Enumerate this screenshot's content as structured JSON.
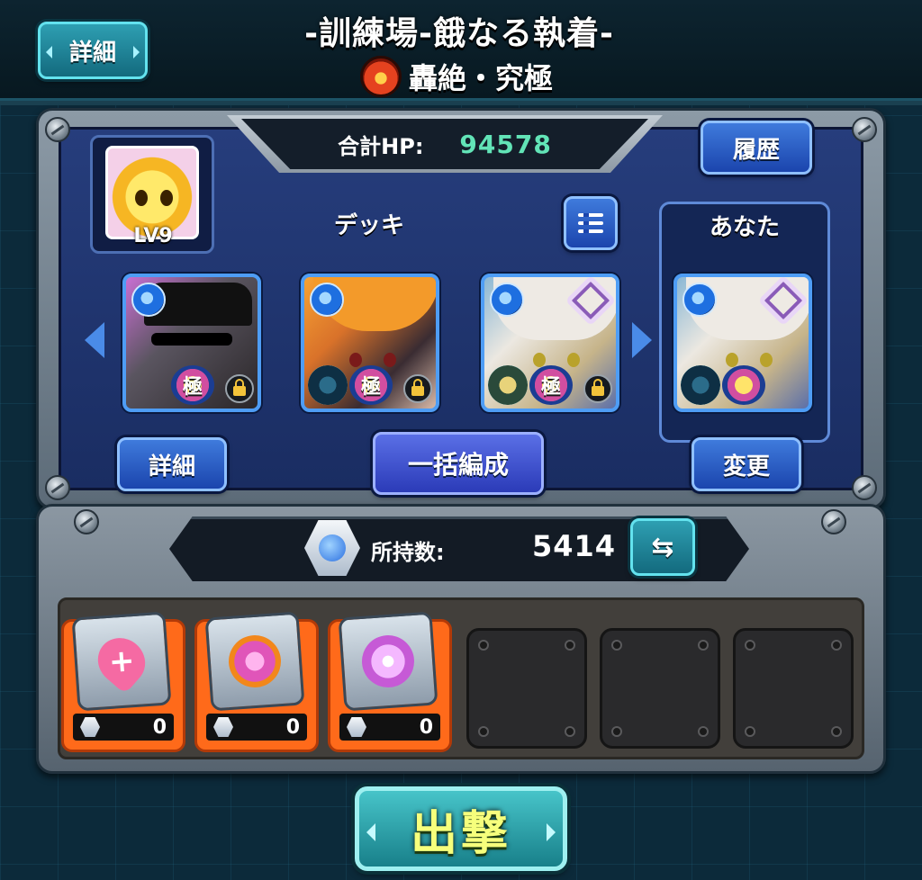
{
  "header": {
    "detail_button": "詳細",
    "title": "-訓練場-餓なる執着-",
    "subtitle": "轟絶・究極",
    "subtitle_icon": "fire-element-icon"
  },
  "party": {
    "total_hp_label": "合計HP:",
    "total_hp_value": "94578",
    "history_button": "履歴",
    "player_level": "LV9",
    "deck_label": "デッキ",
    "you_label": "あなた",
    "detail_button": "詳細",
    "bulk_form_button": "一括編成",
    "change_button": "変更",
    "cards": [
      {
        "id": "c1",
        "element": "water",
        "badge": "極",
        "locked": true
      },
      {
        "id": "c2",
        "element": "water",
        "badge": "極",
        "locked": true
      },
      {
        "id": "c3",
        "element": "water",
        "badge": "極",
        "locked": true
      },
      {
        "id": "c4",
        "element": "water",
        "badge": "",
        "locked": false
      }
    ]
  },
  "items": {
    "owned_label": "所持数:",
    "owned_value": "5414",
    "slots": [
      {
        "name": "heart-plus-item",
        "count": "0"
      },
      {
        "name": "pink-orb-item",
        "count": "0"
      },
      {
        "name": "light-orb-item",
        "count": "0"
      }
    ]
  },
  "launch_button": "出撃",
  "colors": {
    "accent_cyan": "#63e2ee",
    "button_blue": "#1b45ad",
    "hp_value": "#62e4b7",
    "item_slot_orange": "#ff6a1a",
    "launch_text": "#f6ff7c"
  }
}
